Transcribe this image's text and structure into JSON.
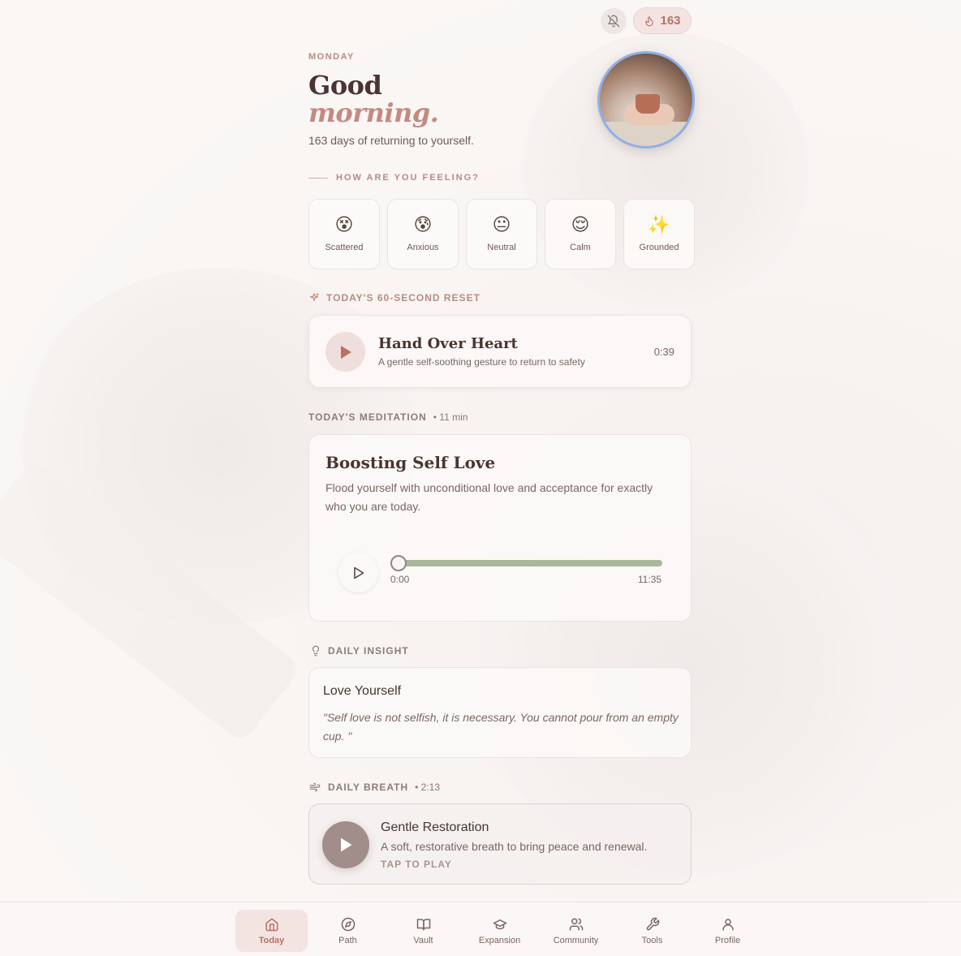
{
  "header": {
    "streak_count": "163"
  },
  "greeting": {
    "day": "MONDAY",
    "line1": "Good",
    "line2": "morning.",
    "subtitle": "163 days of returning to yourself."
  },
  "mood": {
    "label": "HOW ARE YOU FEELING?",
    "options": [
      {
        "emoji": "😵",
        "label": "Scattered"
      },
      {
        "emoji": "😰",
        "label": "Anxious"
      },
      {
        "emoji": "😐",
        "label": "Neutral"
      },
      {
        "emoji": "😌",
        "label": "Calm"
      },
      {
        "emoji": "✨",
        "label": "Grounded"
      }
    ]
  },
  "reset": {
    "section_label": "TODAY'S 60-SECOND RESET",
    "title": "Hand Over Heart",
    "description": "A gentle self-soothing gesture to return to safety",
    "duration": "0:39"
  },
  "meditation": {
    "section_label": "TODAY'S MEDITATION",
    "section_meta": "• 11 min",
    "title": "Boosting Self Love",
    "description": "Flood yourself with unconditional love and acceptance for exactly who you are today.",
    "current_time": "0:00",
    "total_time": "11:35",
    "progress": 0
  },
  "insight": {
    "section_label": "DAILY INSIGHT",
    "title": "Love Yourself",
    "quote": "\"Self love is not selfish, it is necessary. You cannot pour from an empty cup. \""
  },
  "breath": {
    "section_label": "DAILY BREATH",
    "section_meta": "• 2:13",
    "title": "Gentle Restoration",
    "description": "A soft, restorative breath to bring peace and renewal.",
    "action": "TAP TO PLAY"
  },
  "nav": {
    "items": [
      {
        "label": "Today",
        "icon": "home-icon"
      },
      {
        "label": "Path",
        "icon": "compass-icon"
      },
      {
        "label": "Vault",
        "icon": "book-icon"
      },
      {
        "label": "Expansion",
        "icon": "graduation-cap-icon"
      },
      {
        "label": "Community",
        "icon": "users-icon"
      },
      {
        "label": "Tools",
        "icon": "wrench-icon"
      },
      {
        "label": "Profile",
        "icon": "user-icon"
      }
    ],
    "active": "Today"
  },
  "colors": {
    "accent": "#c48a80",
    "heading": "#4a3431",
    "progress_track": "#a9b89a",
    "active_nav_bg": "#f3e4e1"
  }
}
